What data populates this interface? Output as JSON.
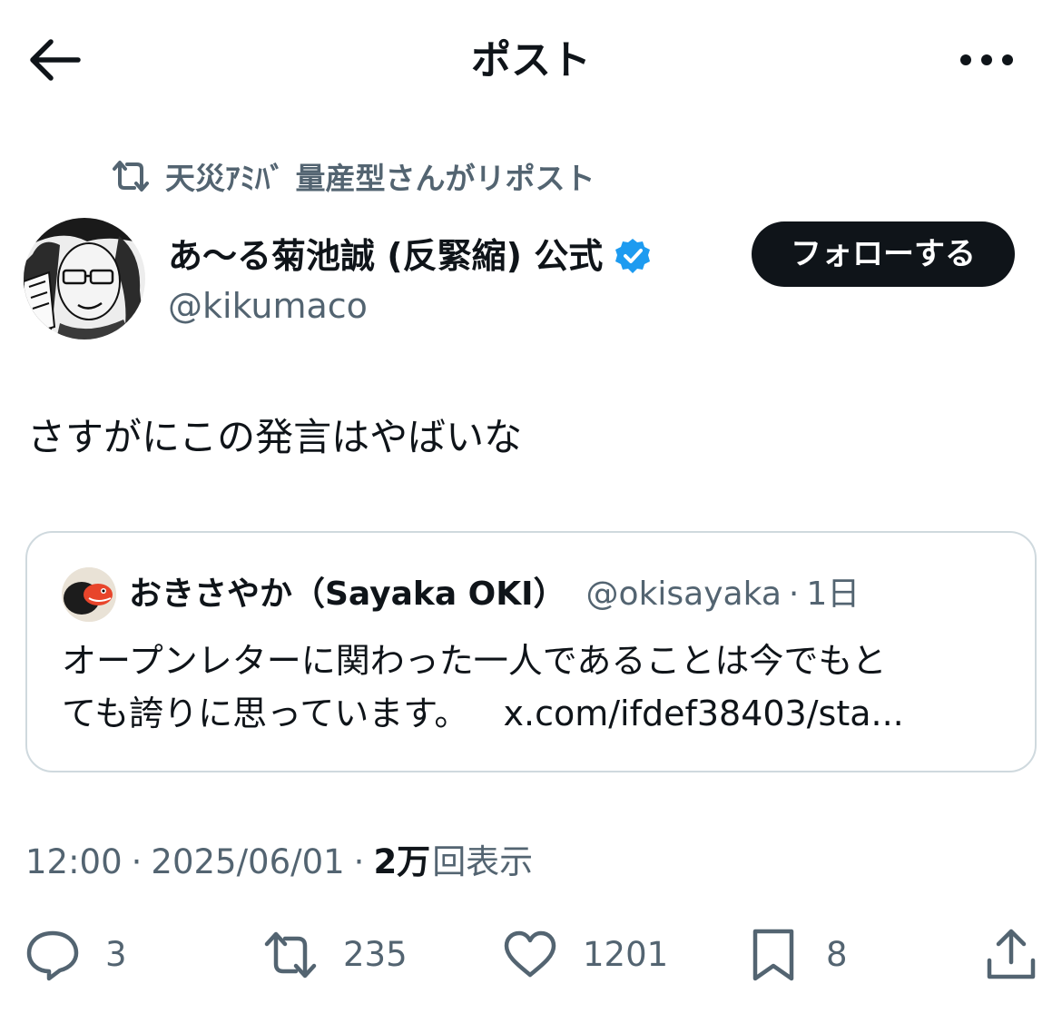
{
  "header": {
    "title": "ポスト"
  },
  "repost": {
    "text": "天災ｱﾐﾊﾞ 量産型さんがリポスト"
  },
  "author": {
    "name": "あ～る菊池誠 (反緊縮) 公式",
    "handle": "@kikumaco",
    "verified": true,
    "follow_label": "フォローする"
  },
  "post": {
    "text": "さすがにこの発言はやばいな"
  },
  "quote": {
    "name": "おきさやか（Sayaka OKI）",
    "handle": "@okisayaka",
    "separator": "·",
    "time": "1日",
    "text_line1": "オープンレターに関わった一人であることは今でもと",
    "text_line2": "ても誇りに思っています。",
    "link": "x.com/ifdef38403/sta..."
  },
  "meta": {
    "time": "12:00",
    "sep1": "·",
    "date": "2025/06/01",
    "sep2": "·",
    "views_count": "2万",
    "views_label": "回表示"
  },
  "actions": {
    "replies": "3",
    "reposts": "235",
    "likes": "1201",
    "bookmarks": "8"
  },
  "colors": {
    "text_primary": "#0f1419",
    "text_secondary": "#536471",
    "verified_blue": "#1d9bf0",
    "border": "#cfd9de"
  },
  "icons": [
    "back-arrow-icon",
    "more-icon",
    "repost-icon",
    "verified-icon",
    "reply-icon",
    "like-icon",
    "bookmark-icon",
    "share-icon"
  ]
}
